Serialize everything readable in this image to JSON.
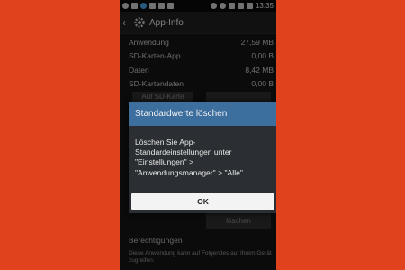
{
  "status_bar": {
    "time": "13:35"
  },
  "action_bar": {
    "title": "App-Info"
  },
  "storage_rows": [
    {
      "label": "Anwendung",
      "value": "27,59 MB"
    },
    {
      "label": "SD-Karten-App",
      "value": "0,00 B"
    },
    {
      "label": "Daten",
      "value": "8,42 MB"
    },
    {
      "label": "SD-Kartendaten",
      "value": "0,00 B"
    }
  ],
  "background_buttons": {
    "move_to_sd": "Auf SD-Karte",
    "clear_defaults": "löschen"
  },
  "permissions": {
    "heading": "Berechtigungen",
    "text": "Diese Anwendung kann auf Folgendes auf Ihrem Gerät zugreifen:"
  },
  "dialog": {
    "title": "Standardwerte löschen",
    "message": "Löschen Sie App-Standardeinstellungen unter \"Einstellungen\" > \"Anwendungsmanager\" > \"Alle\".",
    "ok_label": "OK"
  },
  "colors": {
    "background": "#e1421e",
    "dialog_title": "#3c6e9e",
    "dialog_body": "#2b2f33"
  }
}
